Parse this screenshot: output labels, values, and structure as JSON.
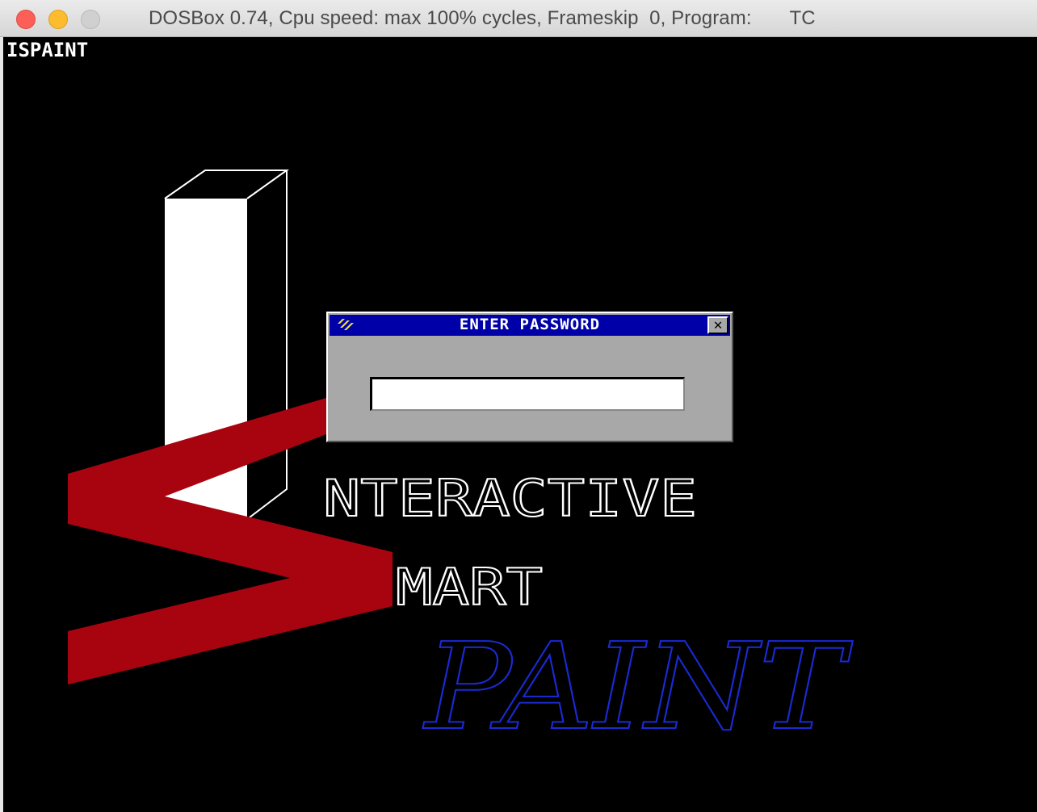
{
  "window": {
    "title": "DOSBox 0.74, Cpu speed: max 100% cycles, Frameskip  0, Program:       TC"
  },
  "program": {
    "name": "ISPAINT"
  },
  "logo": {
    "word_interactive": "NTERACTIVE",
    "word_smart": "MART",
    "word_paint": "PAINT",
    "colors": {
      "bar": "#ffffff",
      "s_shape": "#a80410",
      "paint": "#1a2ad4",
      "outline": "#ffffff"
    }
  },
  "dialog": {
    "title": "ENTER PASSWORD",
    "close_label": "✕",
    "password_value": "",
    "colors": {
      "titlebar": "#0000a8",
      "body": "#a8a8a8"
    }
  }
}
